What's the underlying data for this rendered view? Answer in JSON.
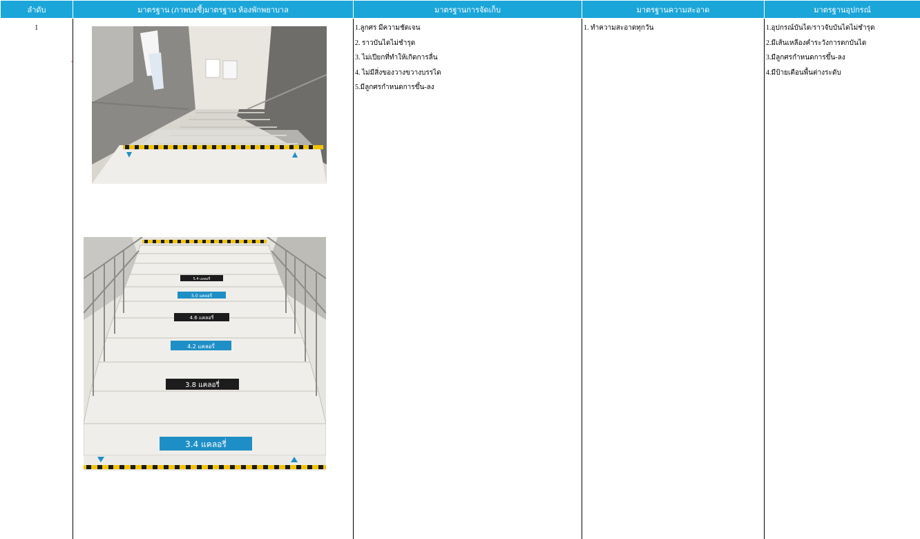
{
  "table": {
    "headers": {
      "order": "ลำดับ",
      "image_standard": "มาตรฐาน (ภาพบงชี้)มาตรฐาน ห้องพักพยาบาล",
      "storage": "มาตรฐานการจัดเก็บ",
      "cleanliness": "มาตรฐานความสะอาด",
      "equipment": "มาตรฐานอุปกรณ์"
    },
    "row": {
      "number": "1",
      "storage_items": [
        "1.ลูกศร มีความชัดเจน",
        "2. ราวบันไดไม่ชำรุด",
        "3. ไม่เปียกที่ทำให้เกิดการลื่น",
        "4. ไม่มีสิ่งของวางขวางบรรได",
        "5.มีลูกศรกำหนดการขึ้น-ลง"
      ],
      "cleanliness_items": [
        "1. ทำความสะอาดทุกวัน"
      ],
      "equipment_items": [
        "1.อุปกรณ์บันได/ราวจับบันไดไม่ชำรุด",
        "2.มีเส้นเหลืองคำระวังการตกบันได",
        "3.มีลูกศรกำหนดการขึ้น-ลง",
        "4.มีป้ายเตือนพื้นต่างระดับ"
      ]
    },
    "stair_labels": [
      "3.4 แคลอรี่",
      "3.8 แคลอรี่",
      "4.2 แคลอรี่",
      "4.6 แคลอรี่",
      "5.0 แคลอรี่",
      "5.4 แคลอรี่"
    ]
  },
  "colors": {
    "header_bg": "#1ba6d9",
    "header_text": "#ffffff",
    "hazard_yellow": "#f2c300",
    "label_blue": "#1e8fc6",
    "label_black": "#1c1c1c"
  }
}
